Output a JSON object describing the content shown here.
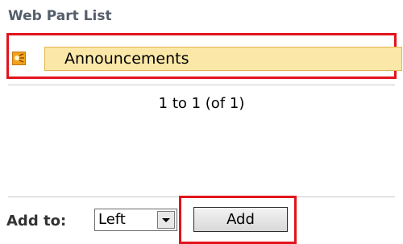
{
  "panel": {
    "title": "Web Part List"
  },
  "list": {
    "items": [
      {
        "label": "Announcements",
        "icon": "announcement-icon"
      }
    ],
    "paging": "1 to 1 (of 1)"
  },
  "footer": {
    "add_to_label": "Add to:",
    "zone_select": {
      "selected": "Left"
    },
    "add_button_label": "Add"
  },
  "colors": {
    "highlight_red": "#e2141b",
    "selected_item_bg": "#fbe8a9",
    "title_color": "#555f6b"
  }
}
